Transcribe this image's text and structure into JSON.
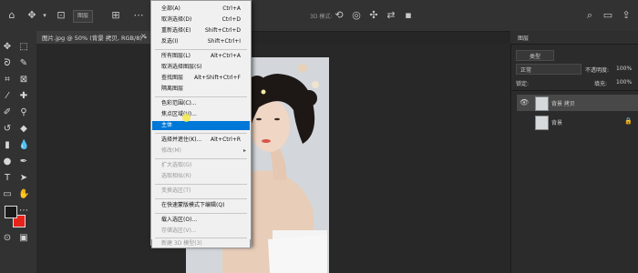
{
  "option_bar": {
    "style_label": "图层",
    "mode_label": "3D 模式:",
    "icons": [
      "home-icon",
      "move-tool-icon",
      "chevron-down-icon",
      "auto-select-icon",
      "align-icon",
      "3d-orbit-icon",
      "3d-roll-icon",
      "3d-pan-icon",
      "3d-slide-icon",
      "3d-scale-icon",
      "search-icon",
      "workspace-icon",
      "share-icon"
    ]
  },
  "document_tab": {
    "title": "图片.jpg @ 50% (背景 拷贝, RGB/8) *",
    "close": "×"
  },
  "select_menu": {
    "items": [
      {
        "label": "全部(A)",
        "shortcut": "Ctrl+A",
        "state": "normal"
      },
      {
        "label": "取消选择(D)",
        "shortcut": "Ctrl+D",
        "state": "normal"
      },
      {
        "label": "重新选择(E)",
        "shortcut": "Shift+Ctrl+D",
        "state": "normal"
      },
      {
        "label": "反选(I)",
        "shortcut": "Shift+Ctrl+I",
        "state": "normal"
      },
      {
        "label": "所有图层(L)",
        "shortcut": "Alt+Ctrl+A",
        "state": "normal"
      },
      {
        "label": "取消选择图层(S)",
        "shortcut": "",
        "state": "normal"
      },
      {
        "label": "查找图层",
        "shortcut": "Alt+Shift+Ctrl+F",
        "state": "normal"
      },
      {
        "label": "隔离图层",
        "shortcut": "",
        "state": "normal"
      },
      {
        "label": "色彩范围(C)...",
        "shortcut": "",
        "state": "normal"
      },
      {
        "label": "焦点区域(U)...",
        "shortcut": "",
        "state": "normal"
      },
      {
        "label": "主体",
        "shortcut": "",
        "state": "highlighted"
      },
      {
        "label": "选择并遮住(K)...",
        "shortcut": "Alt+Ctrl+R",
        "state": "normal"
      },
      {
        "label": "修改(M)",
        "shortcut": "",
        "state": "submenu"
      },
      {
        "label": "扩大选取(G)",
        "shortcut": "",
        "state": "disabled"
      },
      {
        "label": "选取相似(R)",
        "shortcut": "",
        "state": "disabled"
      },
      {
        "label": "变换选区(T)",
        "shortcut": "",
        "state": "disabled"
      },
      {
        "label": "在快速蒙版模式下编辑(Q)",
        "shortcut": "",
        "state": "normal"
      },
      {
        "label": "载入选区(O)...",
        "shortcut": "",
        "state": "normal"
      },
      {
        "label": "存储选区(V)...",
        "shortcut": "",
        "state": "disabled"
      },
      {
        "label": "新建 3D 模型(3)",
        "shortcut": "",
        "state": "disabled"
      }
    ]
  },
  "layers_panel": {
    "tab": "图层",
    "filter_label": "类型",
    "blend_mode": "正常",
    "opacity_label": "不透明度:",
    "opacity_value": "100%",
    "lock_label": "锁定:",
    "fill_label": "填充:",
    "fill_value": "100%",
    "layers": [
      {
        "name": "背景 拷贝",
        "visible": true,
        "selected": true,
        "locked": false
      },
      {
        "name": "背景",
        "visible": false,
        "selected": false,
        "locked": true
      }
    ]
  },
  "colors": {
    "foreground": "#1a1a1a",
    "background": "#e8231b",
    "highlight": "#0078d7"
  }
}
